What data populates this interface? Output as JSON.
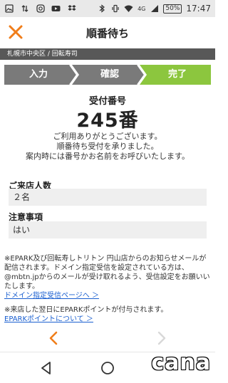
{
  "status_bar": {
    "network": "4G",
    "battery": "50%",
    "time": "17:47"
  },
  "app_bar": {
    "title": "順番待ち"
  },
  "breadcrumb": "札幌市中央区 / 回転寿司",
  "steps": [
    {
      "label": "入力",
      "state": "done"
    },
    {
      "label": "確認",
      "state": "done"
    },
    {
      "label": "完了",
      "state": "current"
    }
  ],
  "receipt": {
    "label": "受付番号",
    "number": "245番"
  },
  "messages": [
    "ご利用ありがとうございます。",
    "順番待ち受付を承りました。",
    "案内時には番号かお名前をお呼びいたします。"
  ],
  "sections": [
    {
      "title": "ご来店人数",
      "value": "２名"
    },
    {
      "title": "注意事項",
      "value": "はい"
    }
  ],
  "notice1": {
    "text": "※EPARK及び回転寿しトリトン 円山店からのお知らせメールが配信されます。ドメイン指定受信を設定されている方は、@mbtn.jpからのメールが受け取れるよう、受信設定をお願いいたします。",
    "link": "ドメイン指定受信ページへ ＞"
  },
  "notice2": {
    "text": "※来店した翌日にEPARKポイントが付与されます。",
    "link": "EPARKポイントについて ＞"
  },
  "watermark": "cana",
  "colors": {
    "accent_orange": "#f07d1a",
    "step_gray": "#7a7a7a",
    "step_current": "#8cc63e",
    "link_blue": "#1a5fd0"
  }
}
